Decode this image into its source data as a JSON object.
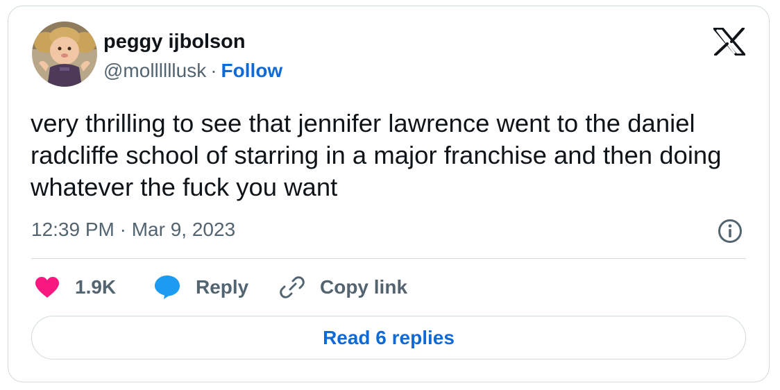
{
  "author": {
    "name": "peggy ijbolson",
    "handle": "@mollllllusk",
    "separator": "·",
    "follow_label": "Follow"
  },
  "tweet": {
    "text": "very thrilling to see that jennifer lawrence went to the daniel radcliffe school of starring in a major franchise and then doing whatever the fuck you want",
    "timestamp": "12:39 PM · Mar 9, 2023"
  },
  "actions": {
    "like_count": "1.9K",
    "reply_label": "Reply",
    "copy_link_label": "Copy link"
  },
  "read_replies_label": "Read 6 replies",
  "icons": {
    "brand": "x-logo-icon",
    "info": "info-icon",
    "like": "heart-icon",
    "reply": "speech-bubble-icon",
    "copy": "link-icon"
  },
  "colors": {
    "like": "#f91880",
    "reply": "#1d9bf0",
    "link": "#0f6ad8",
    "secondary_text": "#536471",
    "border": "#cfd9de"
  }
}
